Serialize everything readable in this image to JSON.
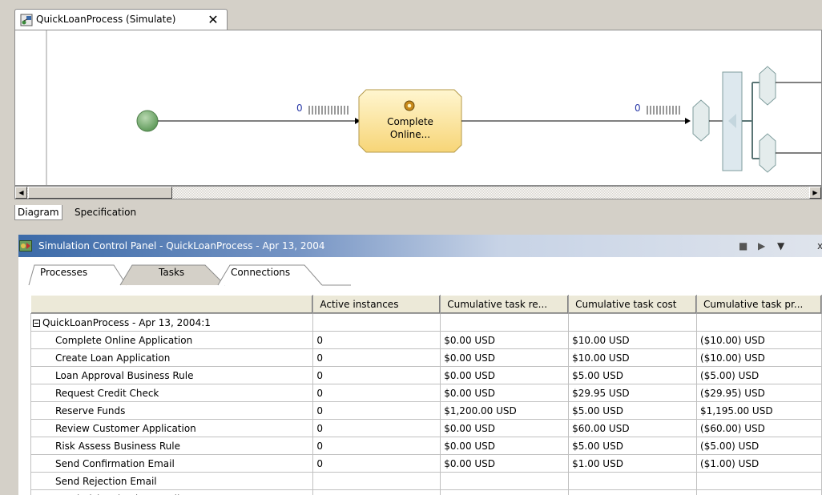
{
  "editor": {
    "tab_title": "QuickLoanProcess (Simulate)",
    "close_glyph": "✕",
    "diagram": {
      "task_label_line1": "Complete",
      "task_label_line2": "Online...",
      "counter_1": "0",
      "counter_2": "0"
    },
    "view_tabs": [
      "Diagram",
      "Specification"
    ]
  },
  "panel": {
    "title": "Simulation Control Panel - QuickLoanProcess - Apr 13, 2004",
    "controls": {
      "stop": "■",
      "play": "▶",
      "menu": "▼",
      "close": "x"
    },
    "tabs": [
      "Processes",
      "Tasks",
      "Connections"
    ],
    "table": {
      "columns": [
        "",
        "Active instances",
        "Cumulative task re...",
        "Cumulative task cost",
        "Cumulative task pr..."
      ],
      "process_row": "QuickLoanProcess - Apr 13, 2004:1",
      "rows": [
        [
          "Complete Online Application",
          "0",
          "$0.00 USD",
          "$10.00 USD",
          "($10.00) USD"
        ],
        [
          "Create Loan Application",
          "0",
          "$0.00 USD",
          "$10.00 USD",
          "($10.00) USD"
        ],
        [
          "Loan Approval Business Rule",
          "0",
          "$0.00 USD",
          "$5.00 USD",
          "($5.00) USD"
        ],
        [
          "Request Credit Check",
          "0",
          "$0.00 USD",
          "$29.95 USD",
          "($29.95) USD"
        ],
        [
          "Reserve Funds",
          "0",
          "$1,200.00 USD",
          "$5.00 USD",
          "$1,195.00 USD"
        ],
        [
          "Review Customer Application",
          "0",
          "$0.00 USD",
          "$60.00 USD",
          "($60.00) USD"
        ],
        [
          "Risk Assess Business Rule",
          "0",
          "$0.00 USD",
          "$5.00 USD",
          "($5.00) USD"
        ],
        [
          "Send Confirmation Email",
          "0",
          "$0.00 USD",
          "$1.00 USD",
          "($1.00) USD"
        ],
        [
          "Send Rejection Email",
          "",
          "",
          "",
          ""
        ],
        [
          "Send Risk Rejection Email",
          "",
          "",
          "",
          ""
        ]
      ]
    }
  }
}
